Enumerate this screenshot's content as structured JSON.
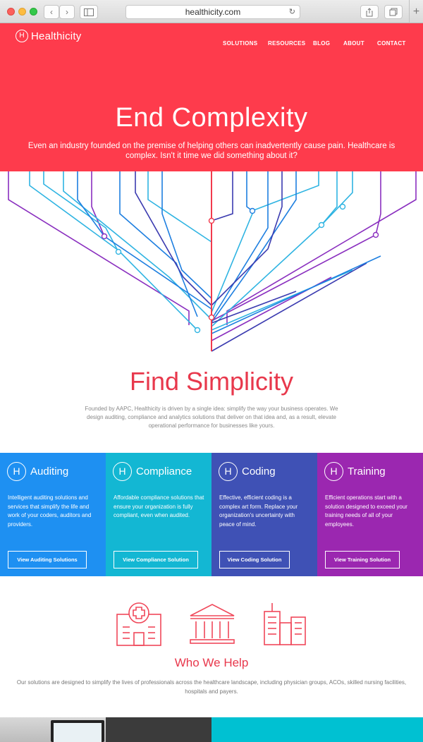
{
  "browser": {
    "url": "healthicity.com",
    "back_icon": "chevron-left-icon",
    "forward_icon": "chevron-right-icon",
    "reload_icon": "reload-icon",
    "new_tab_icon": "plus-icon"
  },
  "header": {
    "logo_mark": "H",
    "logo_text": "Healthicity",
    "nav": [
      "SOLUTIONS",
      "RESOURCES",
      "BLOG",
      "ABOUT",
      "CONTACT"
    ]
  },
  "hero": {
    "title": "End Complexity",
    "subtitle": "Even an industry founded on the premise of helping others can inadvertently cause pain. Healthcare is complex. Isn't it time we did something about it?"
  },
  "intro": {
    "title": "Find Simplicity",
    "text": "Founded by AAPC, Healthicity is driven by a single idea: simplify the way your business operates. We design auditing, compliance and analytics solutions that deliver on that idea and, as a result, elevate operational performance for businesses like yours."
  },
  "solutions": [
    {
      "title": "Auditing",
      "text": "Intelligent auditing solutions and services that simplify the life and work of your coders, auditors and providers.",
      "button": "View Auditing Solutions",
      "color": "#1e90f2"
    },
    {
      "title": "Compliance",
      "text": "Affordable compliance solutions that ensure your organization is fully compliant, even when audited.",
      "button": "View Compliance Solution",
      "color": "#13b7d3"
    },
    {
      "title": "Coding",
      "text": "Effective, efficient coding is a complex art form. Replace your organization's uncertainty with peace of mind.",
      "button": "View Coding Solution",
      "color": "#3f51b5"
    },
    {
      "title": "Training",
      "text": "Efficient operations start with a solution designed to exceed your training needs of all of your employees.",
      "button": "View Training Solution",
      "color": "#9b27b0"
    }
  ],
  "who_we_help": {
    "title": "Who We Help",
    "text": "Our solutions are designed to simplify the lives of professionals across the healthcare landscape, including physician groups, ACOs, skilled nursing facilities, hospitals and payers.",
    "icons": [
      "hospital-icon",
      "bank-icon",
      "city-buildings-icon"
    ]
  },
  "colors": {
    "hero_bg": "#fe3b4c",
    "accent_red": "#e8384c",
    "bottom_cyan": "#00c1d2"
  }
}
